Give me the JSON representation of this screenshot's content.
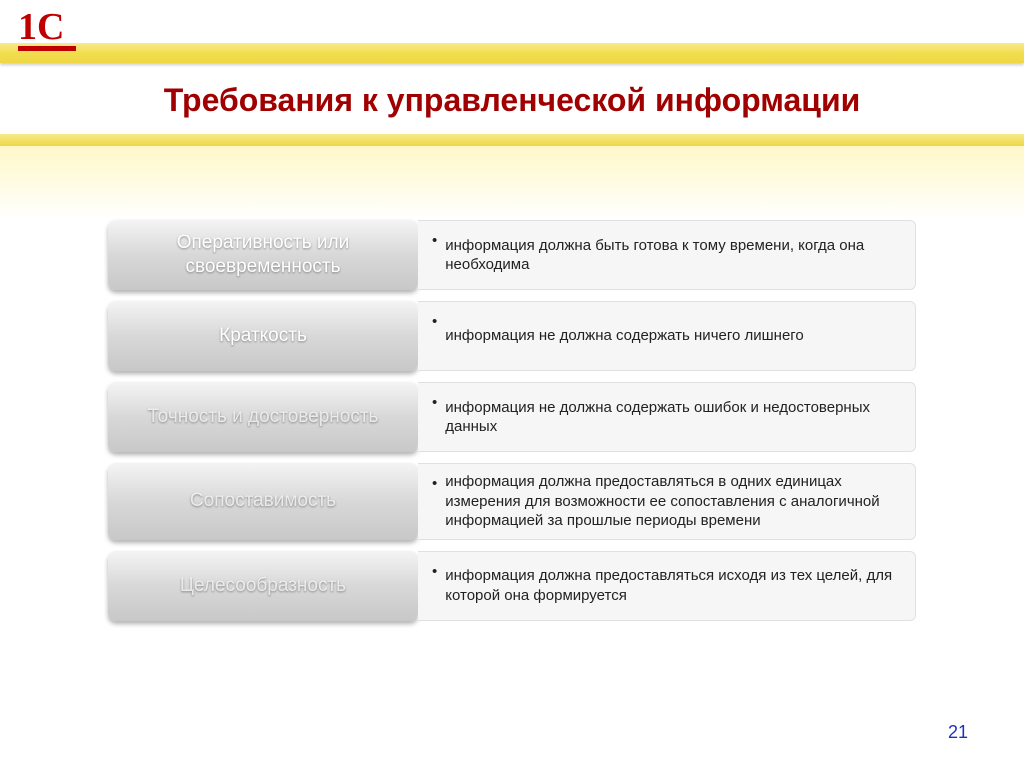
{
  "logo": "1С",
  "title": "Требования к управленческой информации",
  "rows": [
    {
      "label": "Оперативность или своевременность",
      "desc": "информация должна быть готова к тому времени, когда она необходима",
      "faded": false
    },
    {
      "label": "Краткость",
      "desc": "информация не должна содержать ничего лишнего",
      "faded": false
    },
    {
      "label": "Точность и достоверность",
      "desc": "информация не должна содержать ошибок и недостоверных данных",
      "faded": true
    },
    {
      "label": "Сопоставимость",
      "desc": "информация должна предоставляться в одних единицах измерения для возможности ее сопоставления с аналогичной информацией за прошлые периоды времени",
      "faded": true
    },
    {
      "label": "Целесообразность",
      "desc": "информация должна предоставляться исходя из тех целей, для которой она формируется",
      "faded": true
    }
  ],
  "page_number": "21"
}
